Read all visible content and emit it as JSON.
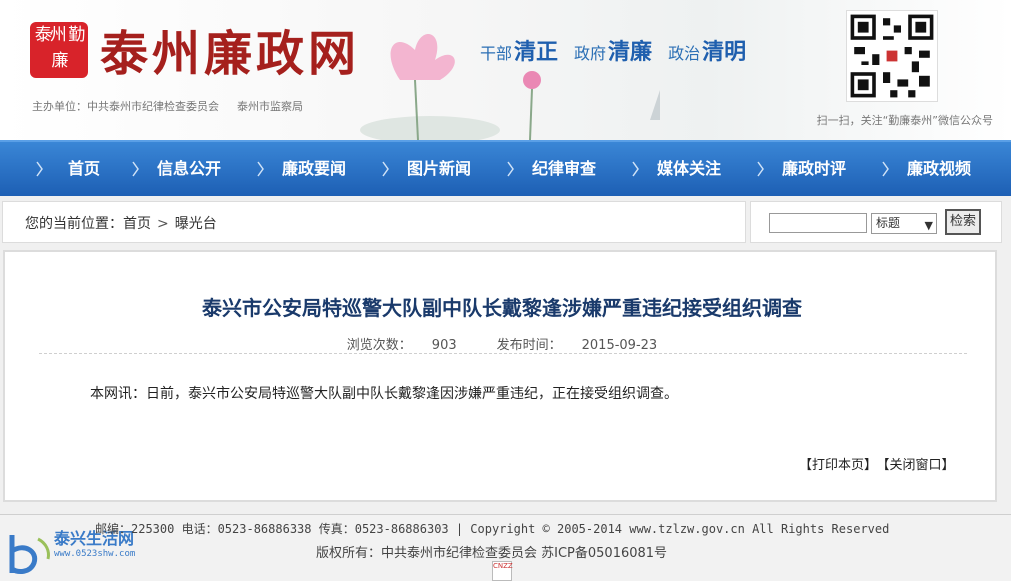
{
  "header": {
    "seal_text": "泰州 勤廉",
    "site_name": "泰州廉政网",
    "sponsor_label": "主办单位：中共泰州市纪律检查委员会",
    "sponsor_2": "泰州市监察局",
    "slogans": [
      {
        "prefix": "干部",
        "word": "清正"
      },
      {
        "prefix": "政府",
        "word": "清廉"
      },
      {
        "prefix": "政治",
        "word": "清明"
      }
    ],
    "qr_caption": "扫一扫，关注“勤廉泰州”微信公众号"
  },
  "nav": {
    "items": [
      "首页",
      "信息公开",
      "廉政要闻",
      "图片新闻",
      "纪律审查",
      "媒体关注",
      "廉政时评",
      "廉政视频"
    ]
  },
  "breadcrumb": {
    "prefix": "您的当前位置：",
    "home": "首页",
    "current": "曝光台"
  },
  "search": {
    "value": "",
    "select_value": "标题",
    "button_label": "检索"
  },
  "article": {
    "title": "泰兴市公安局特巡警大队副中队长戴黎逢涉嫌严重违纪接受组织调查",
    "views_label": "浏览次数：",
    "views": "903",
    "date_label": "发布时间：",
    "date": "2015-09-23",
    "body": "本网讯：日前，泰兴市公安局特巡警大队副中队长戴黎逢因涉嫌严重违纪，正在接受组织调查。",
    "print_label": "【打印本页】",
    "close_label": "【关闭窗口】"
  },
  "footer": {
    "line1": "邮编：225300  电话：0523-86886338  传真：0523-86886303 |  Copyright © 2005-2014 www.tzlzw.gov.cn All Rights Reserved",
    "line2": "版权所有：中共泰州市纪律检查委员会   苏ICP备05016081号",
    "watermark_name": "泰兴生活网",
    "watermark_url": "www.0523shw.com",
    "cnzz": "CNZZ"
  },
  "colors": {
    "nav_top": "#3a86d6",
    "nav_bottom": "#1d5fb4",
    "title": "#1a3a6b",
    "brand_red": "#a5201d"
  }
}
